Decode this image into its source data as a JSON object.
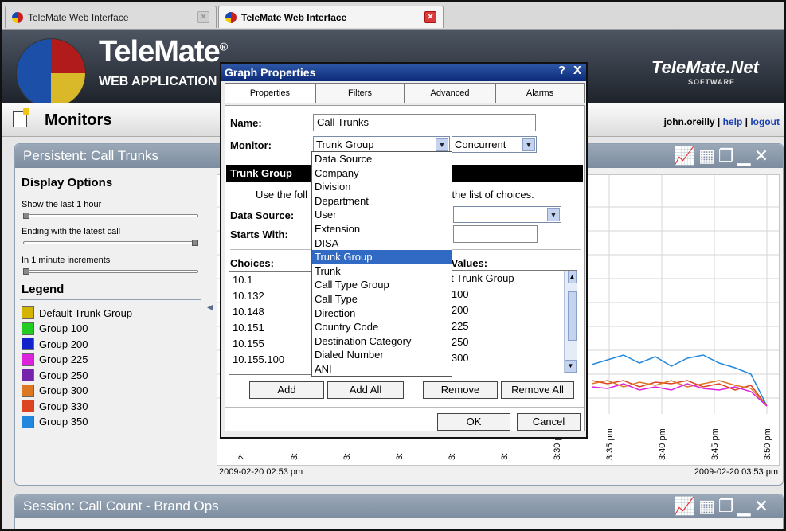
{
  "browser": {
    "tabs": [
      {
        "title": "TeleMate Web Interface",
        "active": false
      },
      {
        "title": "TeleMate Web Interface",
        "active": true
      }
    ]
  },
  "header": {
    "brand": "TeleMate",
    "brand_mark": "®",
    "subtitle": "WEB APPLICATION",
    "right_brand": "TeleMate.Net",
    "right_sub": "SOFTWARE"
  },
  "monitors_bar": {
    "title": "Monitors",
    "user": "john.oreilly",
    "separator": "|",
    "help": "help",
    "logout": "logout"
  },
  "panel1": {
    "title": "Persistent: Call Trunks",
    "display_options_title": "Display Options",
    "opt1": "Show the last 1 hour",
    "opt2": "Ending with the latest call",
    "opt3": "In 1 minute increments",
    "legend_title": "Legend",
    "legend": [
      {
        "label": "Default Trunk Group",
        "color": "#d4b400"
      },
      {
        "label": "Group 100",
        "color": "#22cc22"
      },
      {
        "label": "Group 200",
        "color": "#1122cc"
      },
      {
        "label": "Group 225",
        "color": "#dd22dd"
      },
      {
        "label": "Group 250",
        "color": "#7722aa"
      },
      {
        "label": "Group 300",
        "color": "#dd7722"
      },
      {
        "label": "Group 330",
        "color": "#dd4422"
      },
      {
        "label": "Group 350",
        "color": "#2288dd"
      }
    ],
    "x_ticks": [
      "2:",
      "3:",
      "3:",
      "3:",
      "3:",
      "3:",
      "3:30 pm",
      "3:35 pm",
      "3:40 pm",
      "3:45 pm",
      "3:50 pm"
    ],
    "date_start": "2009-02-20 02:53 pm",
    "date_end": "2009-02-20 03:53 pm"
  },
  "panel2": {
    "title": "Session: Call Count - Brand Ops"
  },
  "dialog": {
    "title": "Graph Properties",
    "help": "?",
    "close": "X",
    "tabs": [
      "Properties",
      "Filters",
      "Advanced",
      "Alarms"
    ],
    "name_label": "Name:",
    "name_value": "Call Trunks",
    "monitor_label": "Monitor:",
    "monitor_value": "Trunk Group",
    "mode_value": "Concurrent",
    "section_title": "Trunk Group",
    "instruction_left": "Use the foll",
    "instruction_right": "m the list of choices.",
    "data_source_label": "Data Source:",
    "starts_with_label": "Starts With:",
    "choices_label": "Choices:",
    "selected_label": "d Values:",
    "choices": [
      "10.1",
      "10.132",
      "10.148",
      "10.151",
      "10.155",
      "10.155.100"
    ],
    "selected": [
      "ult Trunk Group",
      "p 100",
      "p 200",
      "p 225",
      "p 250",
      "p 300"
    ],
    "btn_add": "Add",
    "btn_add_all": "Add All",
    "btn_remove": "Remove",
    "btn_remove_all": "Remove All",
    "btn_ok": "OK",
    "btn_cancel": "Cancel",
    "dropdown_options": [
      "Data Source",
      "Company",
      "Division",
      "Department",
      "User",
      "Extension",
      "DISA",
      "Trunk Group",
      "Trunk",
      "Call Type Group",
      "Call Type",
      "Direction",
      "Country Code",
      "Destination Category",
      "Dialed Number",
      "ANI"
    ],
    "dropdown_selected_index": 7
  }
}
